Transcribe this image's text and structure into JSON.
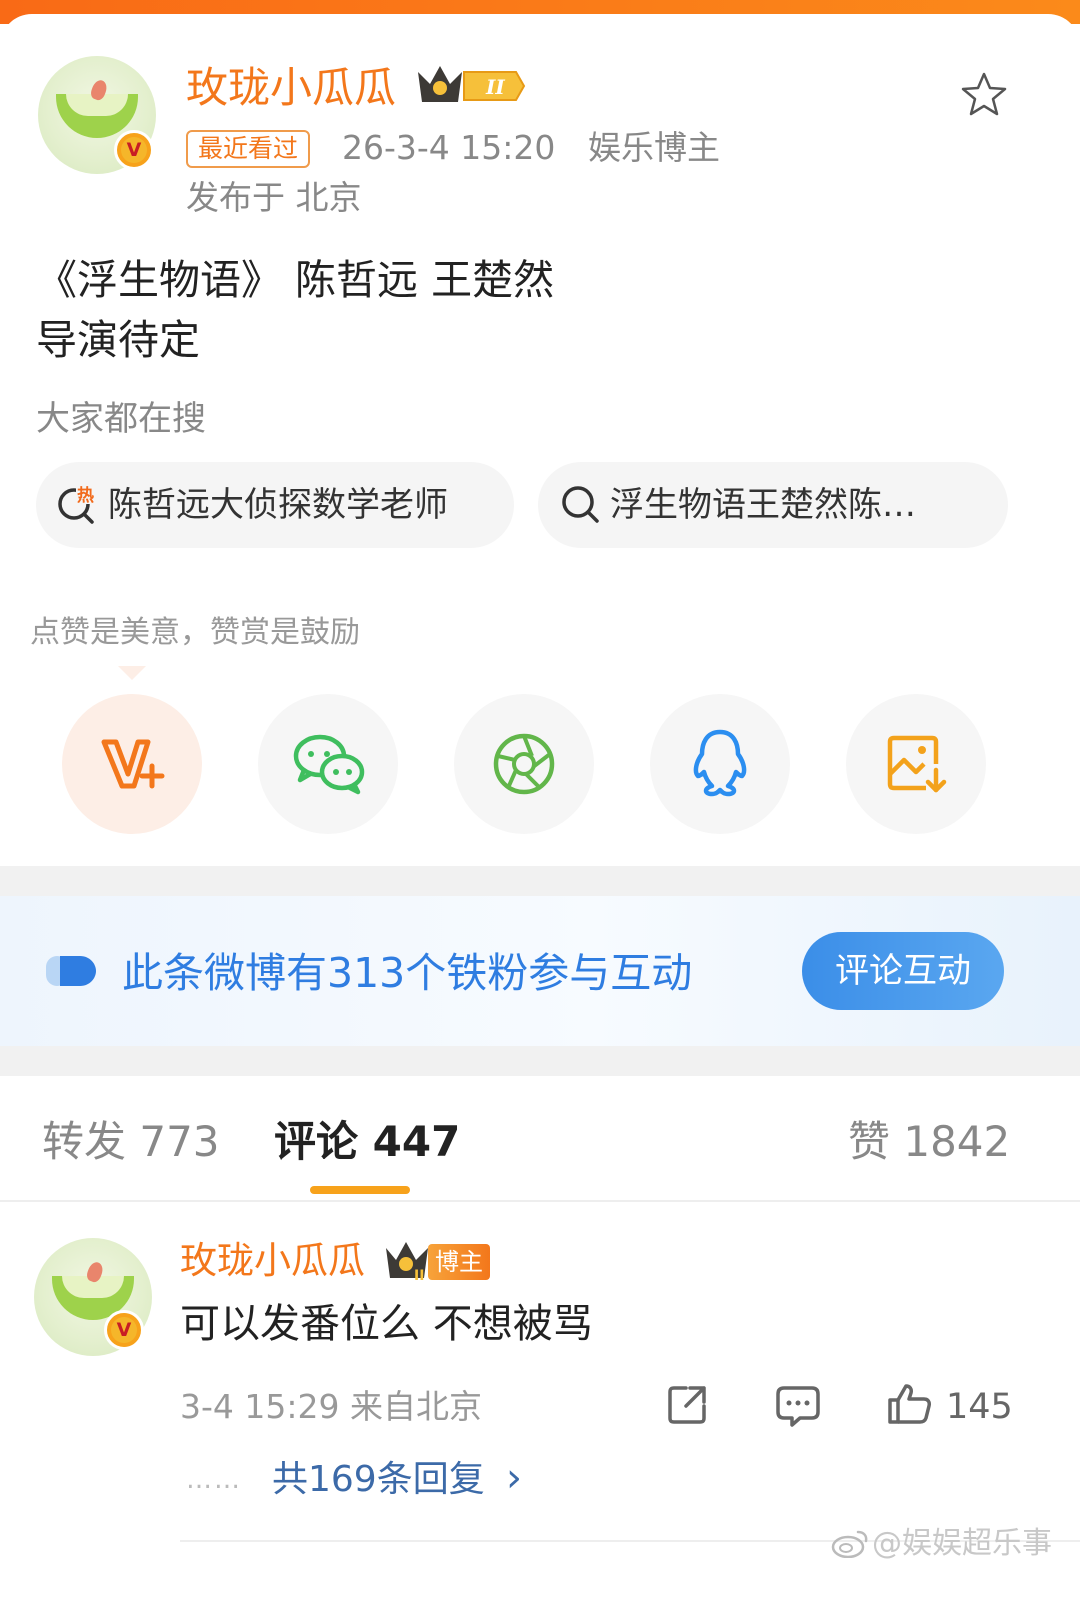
{
  "post": {
    "author": "玫珑小瓜瓜",
    "level_badge": "II",
    "recent_tag": "最近看过",
    "timestamp": "26-3-4 15:20",
    "role": "娱乐博主",
    "location": "发布于 北京",
    "content_line1": "《浮生物语》 陈哲远 王楚然",
    "content_line2": "导演待定"
  },
  "search": {
    "heading": "大家都在搜",
    "chips": [
      {
        "label": "陈哲远大侦探数学老师",
        "icon": "hot-search-icon"
      },
      {
        "label": "浮生物语王楚然陈…",
        "icon": "search-icon"
      }
    ]
  },
  "reward": {
    "text": "点赞是美意，赞赏是鼓励",
    "buttons": [
      "v-plus-reward-icon",
      "wechat-icon",
      "moments-icon",
      "qq-icon",
      "save-image-icon"
    ]
  },
  "banner": {
    "text": "此条微博有313个铁粉参与互动",
    "button": "评论互动"
  },
  "tabs": {
    "repost": "转发 773",
    "comments": "评论 447",
    "likes": "赞 1842"
  },
  "comment": {
    "author": "玫珑小瓜瓜",
    "badge": "博主",
    "level_badge": "II",
    "text": "可以发番位么 不想被骂",
    "meta": "3-4 15:29 来自北京",
    "like_count": "145",
    "replies_dots": "……",
    "replies": "共169条回复",
    "replies_arrow": "›"
  },
  "watermark": "@娱娱超乐事",
  "colors": {
    "brand_orange": "#f3771b",
    "blue_accent": "#2f7de1",
    "tab_underline": "#f7a21b"
  }
}
